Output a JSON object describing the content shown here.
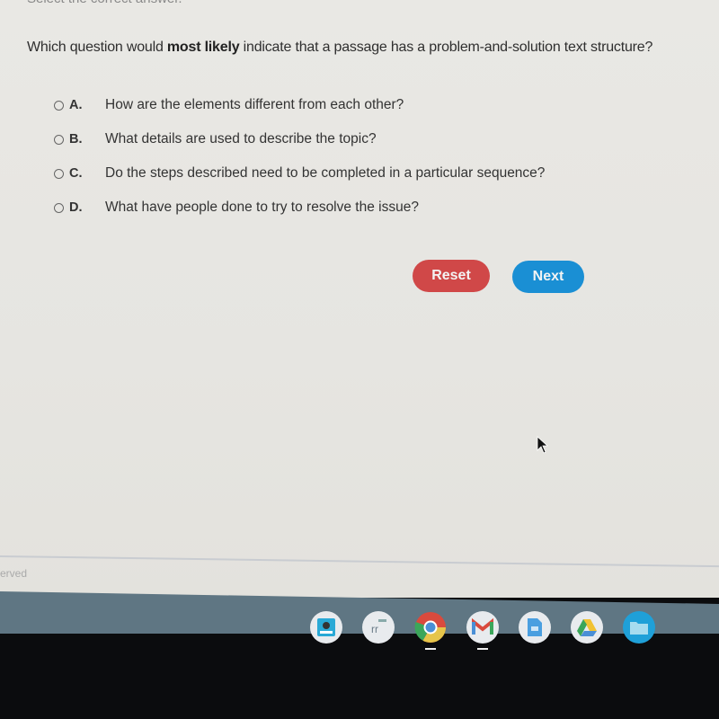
{
  "instruction": "Select the correct answer.",
  "question": {
    "before": "Which question would ",
    "bold": "most likely",
    "after": " indicate that a passage has a problem-and-solution text structure?"
  },
  "options": [
    {
      "letter": "A.",
      "text": "How are the elements different from each other?"
    },
    {
      "letter": "B.",
      "text": "What details are used to describe the topic?"
    },
    {
      "letter": "C.",
      "text": "Do the steps described need to be completed in a particular sequence?"
    },
    {
      "letter": "D.",
      "text": "What have people done to try to resolve the issue?"
    }
  ],
  "buttons": {
    "reset": "Reset",
    "next": "Next"
  },
  "footer": {
    "text": "erved"
  },
  "colors": {
    "reset": "#d04848",
    "next": "#1a8fd4",
    "shelf": "#5f7683"
  },
  "shelf_apps": [
    {
      "name": "app-launcher-icon"
    },
    {
      "name": "rr-app-icon"
    },
    {
      "name": "chrome-icon"
    },
    {
      "name": "gmail-icon"
    },
    {
      "name": "docs-icon"
    },
    {
      "name": "drive-icon"
    },
    {
      "name": "files-icon"
    }
  ]
}
